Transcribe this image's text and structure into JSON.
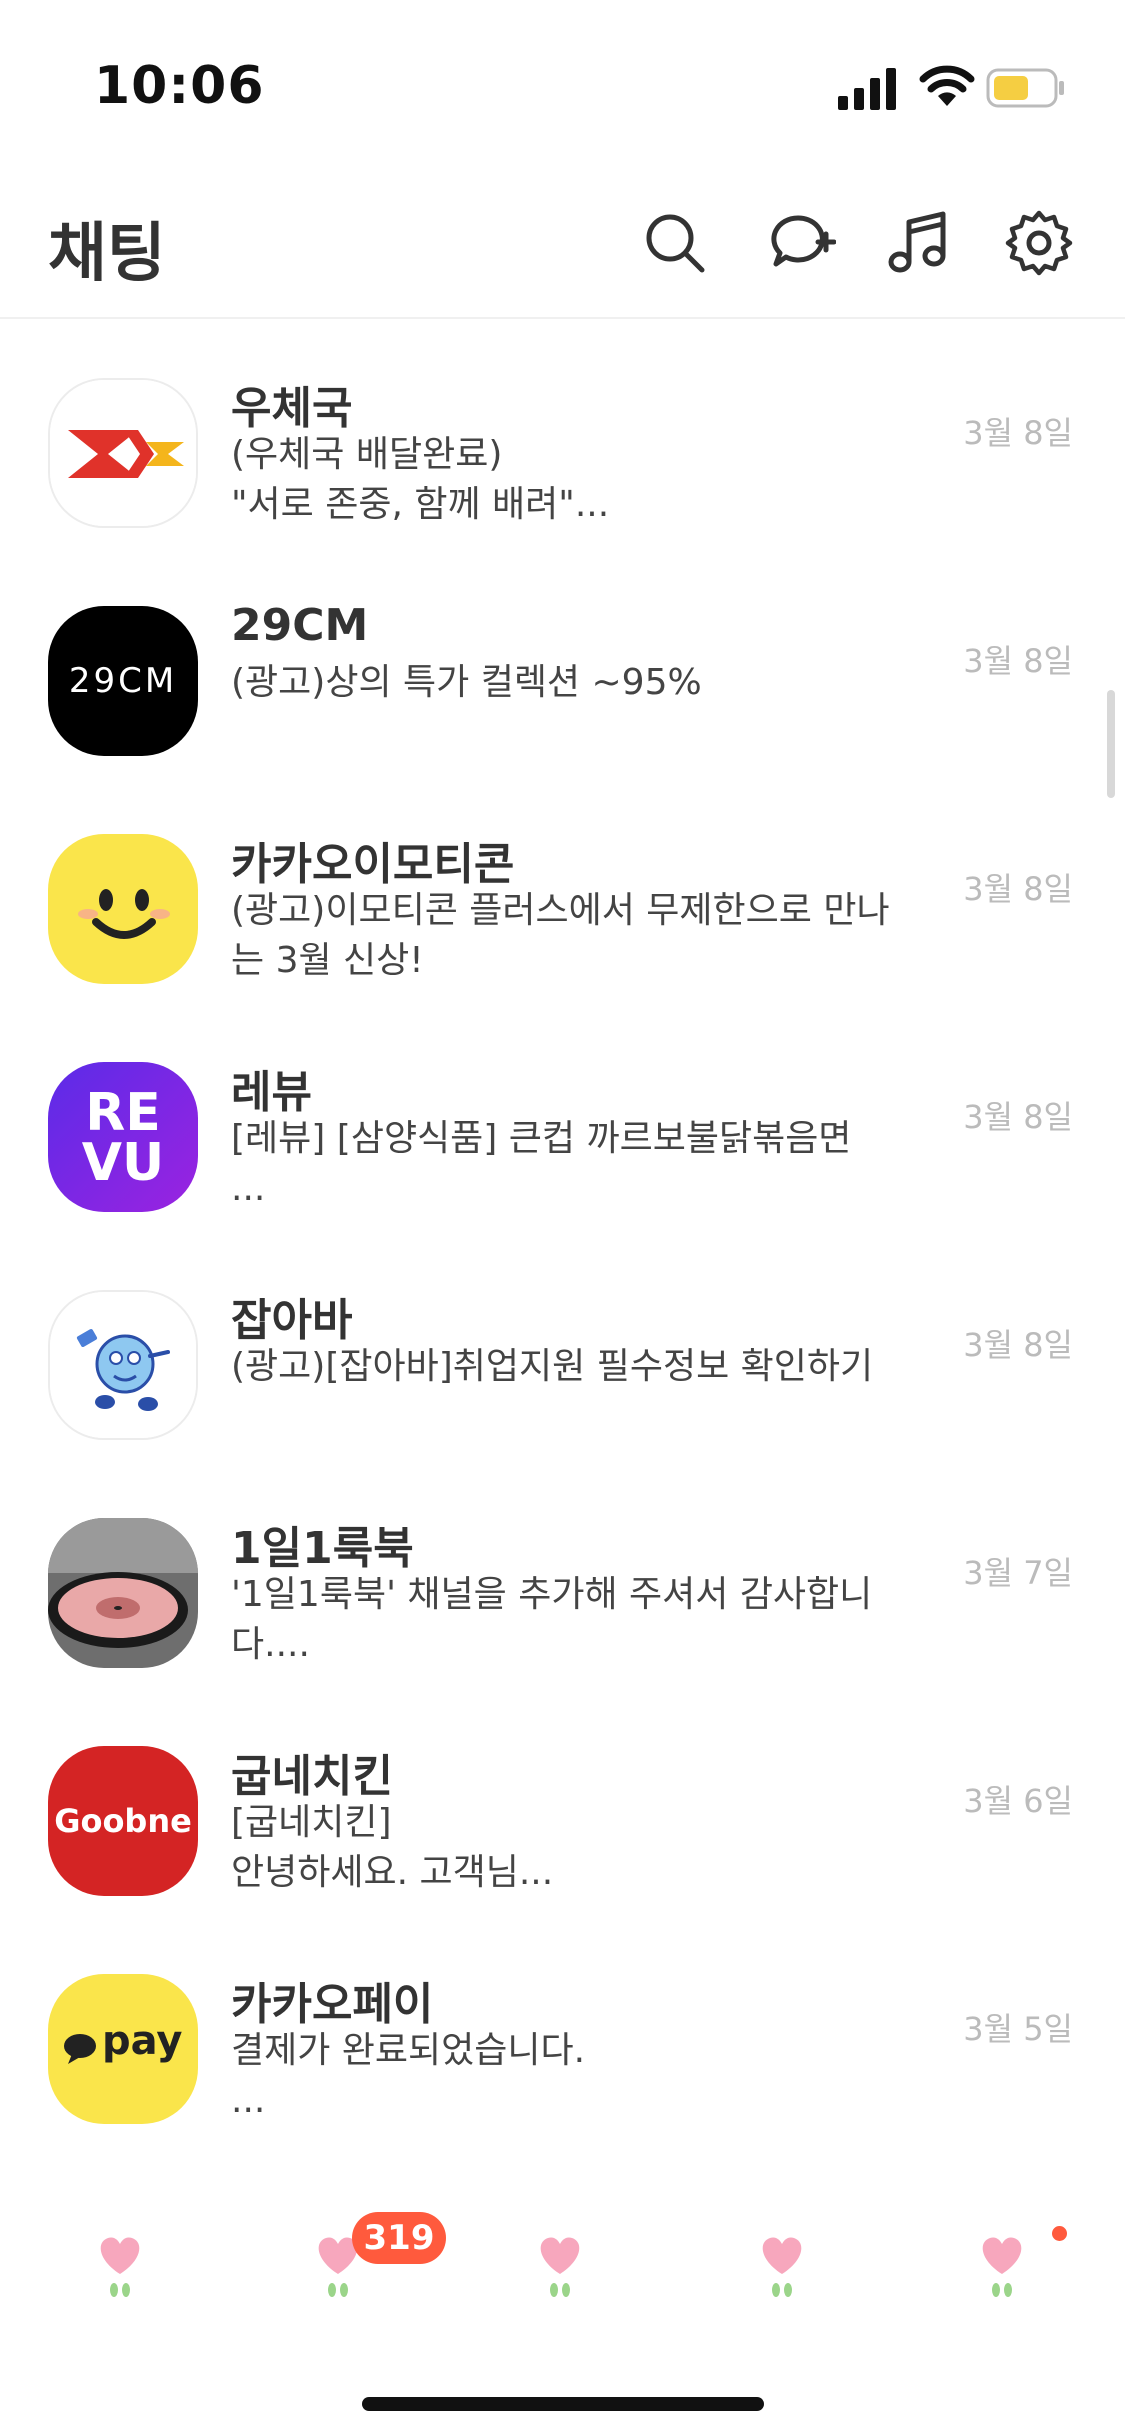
{
  "status_bar": {
    "time": "10:06"
  },
  "header": {
    "title": "채팅",
    "icons": [
      "search-icon",
      "new-chat-icon",
      "music-icon",
      "settings-icon"
    ]
  },
  "chats": [
    {
      "name": "우체국",
      "message": "(우체국 배달완료)\n\"서로 존중, 함께 배려\"...",
      "date": "3월 8일",
      "avatar": "post-office-logo"
    },
    {
      "name": "29CM",
      "message": "(광고)상의 특가 컬렉션 ~95%",
      "date": "3월 8일",
      "avatar": "29cm-logo",
      "logo_text": "29CM"
    },
    {
      "name": "카카오이모티콘",
      "message": "(광고)이모티콘 플러스에서 무제한으로 만나\n는 3월 신상!",
      "date": "3월 8일",
      "avatar": "kakao-emoticon-logo"
    },
    {
      "name": "레뷰",
      "message": "[레뷰] [삼양식품] 큰컵 까르보불닭볶음면\n...",
      "date": "3월 8일",
      "avatar": "revu-logo",
      "logo_text_1": "RE",
      "logo_text_2": "VU"
    },
    {
      "name": "잡아바",
      "message": "(광고)[잡아바]취업지원 필수정보 확인하기",
      "date": "3월 8일",
      "avatar": "jobaba-logo"
    },
    {
      "name": "1일1룩북",
      "message": "'1일1룩북' 채널을 추가해 주셔서 감사합니\n다....",
      "date": "3월 7일",
      "avatar": "record-photo"
    },
    {
      "name": "굽네치킨",
      "message": "[굽네치킨]\n안녕하세요. 고객님...",
      "date": "3월 6일",
      "avatar": "goobne-logo",
      "logo_text": "Goobne"
    },
    {
      "name": "카카오페이",
      "message": "결제가 완료되었습니다.\n...",
      "date": "3월 5일",
      "avatar": "kakaopay-logo",
      "logo_text": "pay"
    }
  ],
  "tab_bar": {
    "tabs": [
      "tab-friends",
      "tab-chats",
      "tab-view",
      "tab-shopping",
      "tab-more"
    ],
    "chat_badge": "319",
    "colors": {
      "petal": "#f7a7bd",
      "leaf": "#9bd58a",
      "badge": "#ff5a3d"
    }
  },
  "colors": {
    "kakao_yellow": "#fae54b",
    "post_red": "#e0322a",
    "revu_purple": "#6a25e6",
    "goobne_red": "#d42424"
  }
}
